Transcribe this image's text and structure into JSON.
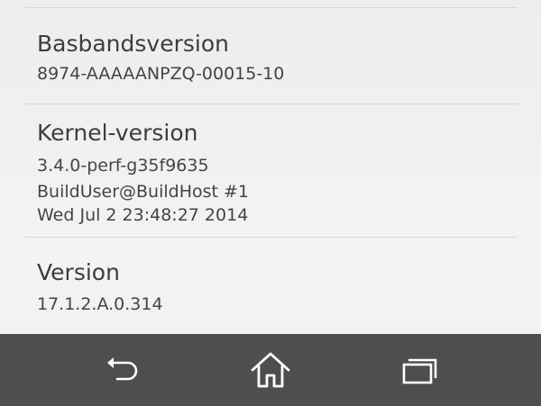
{
  "settings": {
    "items": [
      {
        "title": "Basbandsversion",
        "lines": [
          "8974-AAAAANPZQ-00015-10"
        ]
      },
      {
        "title": "Kernel-version",
        "lines": [
          "3.4.0-perf-g35f9635",
          "BuildUser@BuildHost #1",
          "Wed Jul 2 23:48:27 2014"
        ]
      },
      {
        "title": "Version",
        "lines": [
          "17.1.2.A.0.314"
        ]
      }
    ]
  },
  "navbar": {
    "buttons": [
      {
        "icon": "back-icon"
      },
      {
        "icon": "home-icon"
      },
      {
        "icon": "recent-apps-icon"
      }
    ],
    "background_color": "#4e4e4e",
    "icon_color": "#ffffff"
  }
}
